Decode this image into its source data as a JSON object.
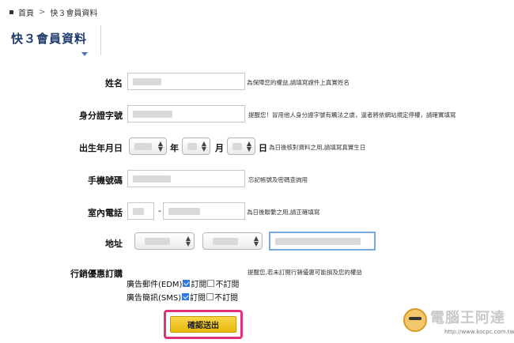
{
  "breadcrumb": {
    "home": "首頁",
    "separator": ">",
    "current": "快３會員資料"
  },
  "page_title": "快３會員資料",
  "form": {
    "name": {
      "label": "姓名",
      "hint": "為保障您的權益,請填寫證件上真實姓名"
    },
    "id_number": {
      "label": "身分證字號",
      "hint": "提醒您！冒用他人身分證字號有觸法之虞，違者將依網站規定停權，請確實填寫"
    },
    "birthday": {
      "label": "出生年月日",
      "year_unit": "年",
      "month_unit": "月",
      "day_unit": "日",
      "hint": "為日後核對資料之用,請填寫真實生日"
    },
    "mobile": {
      "label": "手機號碼",
      "hint": "忘記帳號及密碼查詢用"
    },
    "phone": {
      "label": "室內電話",
      "dash": "-",
      "hint": "為日後聯繫之用,請正確填寫"
    },
    "address": {
      "label": "地址"
    },
    "marketing": {
      "label": "行銷優惠訂購",
      "hint": "提醒您,若未訂閱行銷優惠可能損及您的權益",
      "edm": {
        "label": "廣告郵件(EDM)",
        "subscribe": "訂閱",
        "unsubscribe": "不訂閱",
        "subscribed": true
      },
      "sms": {
        "label": "廣告簡訊(SMS)",
        "subscribe": "訂閱",
        "unsubscribe": "不訂閱",
        "subscribed": true
      }
    },
    "submit_label": "確認送出"
  },
  "watermark": {
    "text": "電腦王阿達",
    "url": "http://www.kocpc.com.tw"
  },
  "colors": {
    "title": "#1e3a6e",
    "highlight": "#e0317c",
    "button": "#f0c52a",
    "checkbox": "#2f7de1"
  }
}
